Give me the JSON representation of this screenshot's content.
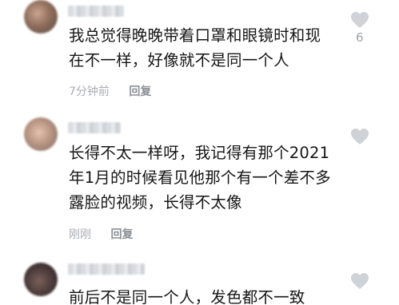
{
  "comments": [
    {
      "lines": [
        "我总觉得晚晚带着口罩和眼镜时和现",
        "在不一样，好像就不是同一个人"
      ],
      "time": "7分钟前",
      "reply_label": "回复",
      "like_count": "6"
    },
    {
      "lines": [
        "长得不太一样呀，我记得有那个2021",
        "年1月的时候看见他那个有一个差不多",
        "露脸的视频，长得不太像"
      ],
      "time": "刚刚",
      "reply_label": "回复",
      "like_count": ""
    },
    {
      "lines": [
        "前后不是同一个人，发色都不一致"
      ],
      "time": "",
      "reply_label": "",
      "like_count": ""
    }
  ],
  "icons": {
    "like": "heart-icon"
  },
  "colors": {
    "text": "#161616",
    "meta": "#a8acb2",
    "heart": "#cfd2d6"
  }
}
